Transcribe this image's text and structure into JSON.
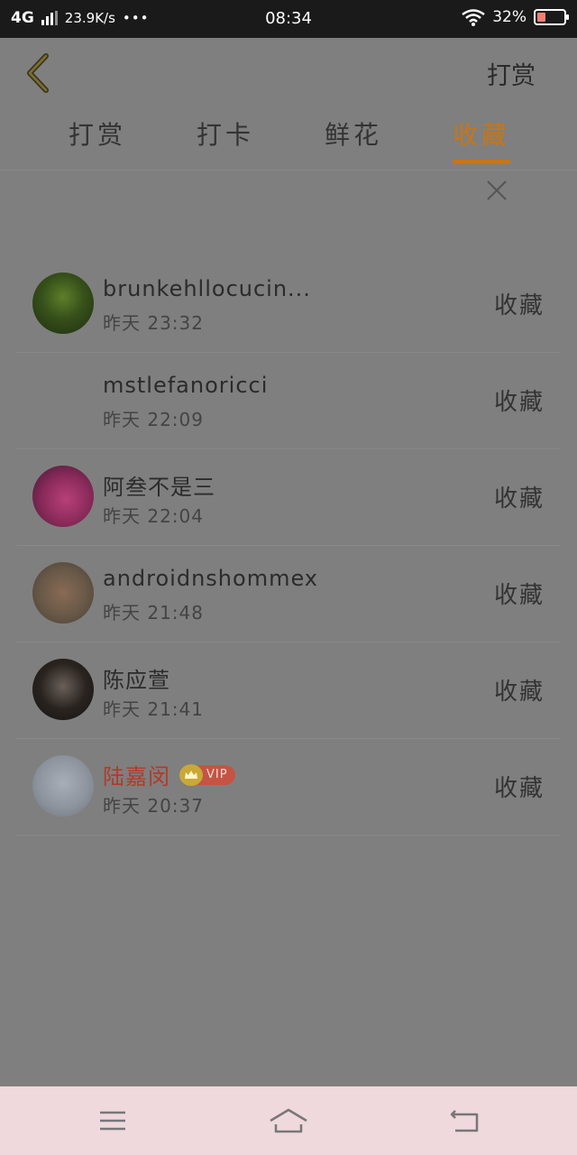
{
  "status_bar": {
    "network": "4G",
    "speed": "23.9K/s",
    "dots": "•••",
    "time": "08:34",
    "battery": "32%",
    "battery_level": 0.32
  },
  "header": {
    "action": "打赏"
  },
  "tabs": [
    {
      "label": "打赏",
      "active": false
    },
    {
      "label": "打卡",
      "active": false
    },
    {
      "label": "鲜花",
      "active": false
    },
    {
      "label": "收藏",
      "active": true
    }
  ],
  "list": [
    {
      "name": "brunkehllocucin...",
      "time": "昨天 23:32",
      "action": "收藏",
      "vip": false
    },
    {
      "name": "mstlefanoricci",
      "time": "昨天 22:09",
      "action": "收藏",
      "vip": false
    },
    {
      "name": "阿叁不是三",
      "time": "昨天 22:04",
      "action": "收藏",
      "vip": false
    },
    {
      "name": "androidnshommex",
      "time": "昨天 21:48",
      "action": "收藏",
      "vip": false
    },
    {
      "name": "陈应萱",
      "time": "昨天 21:41",
      "action": "收藏",
      "vip": false
    },
    {
      "name": "陆嘉闵",
      "time": "昨天 20:37",
      "action": "收藏",
      "vip": true,
      "badge": "VIP"
    }
  ],
  "colors": {
    "accent": "#c87515",
    "overlay": "#7f7f7f",
    "vip_name": "#b23a28"
  }
}
